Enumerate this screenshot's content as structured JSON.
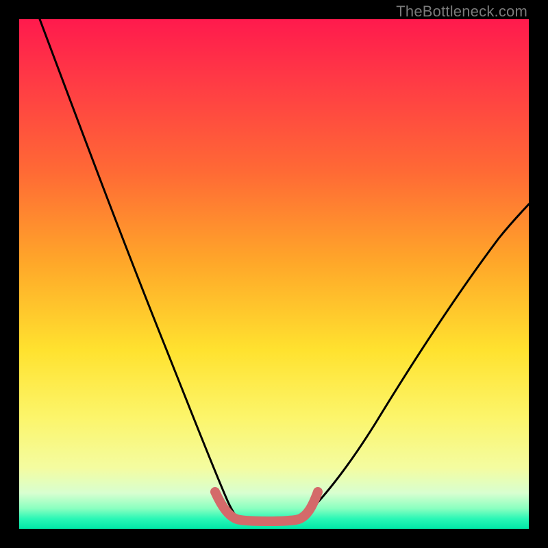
{
  "watermark": "TheBottleneck.com",
  "chart_data": {
    "type": "line",
    "title": "",
    "xlabel": "",
    "ylabel": "",
    "xlim": [
      0,
      100
    ],
    "ylim": [
      0,
      100
    ],
    "grid": false,
    "legend": false,
    "series": [
      {
        "name": "left-branch",
        "color": "#000000",
        "x": [
          4,
          10,
          16,
          22,
          28,
          33,
          37,
          40,
          42
        ],
        "y": [
          100,
          80,
          60,
          42,
          26,
          14,
          7,
          4,
          3
        ]
      },
      {
        "name": "right-branch",
        "color": "#000000",
        "x": [
          55,
          58,
          62,
          68,
          75,
          83,
          90,
          96,
          100
        ],
        "y": [
          3,
          4,
          7,
          13,
          22,
          33,
          44,
          54,
          60
        ]
      },
      {
        "name": "bottom-highlight",
        "color": "#d46a6a",
        "x": [
          38,
          41,
          44,
          48,
          52,
          55,
          57
        ],
        "y": [
          7,
          3,
          2,
          2,
          2,
          3,
          7
        ]
      }
    ],
    "background_gradient": {
      "top": "#ff1a4d",
      "upper_mid": "#ffa829",
      "mid": "#ffe22f",
      "lower_mid": "#f4fca0",
      "bottom": "#00e8a8"
    }
  }
}
